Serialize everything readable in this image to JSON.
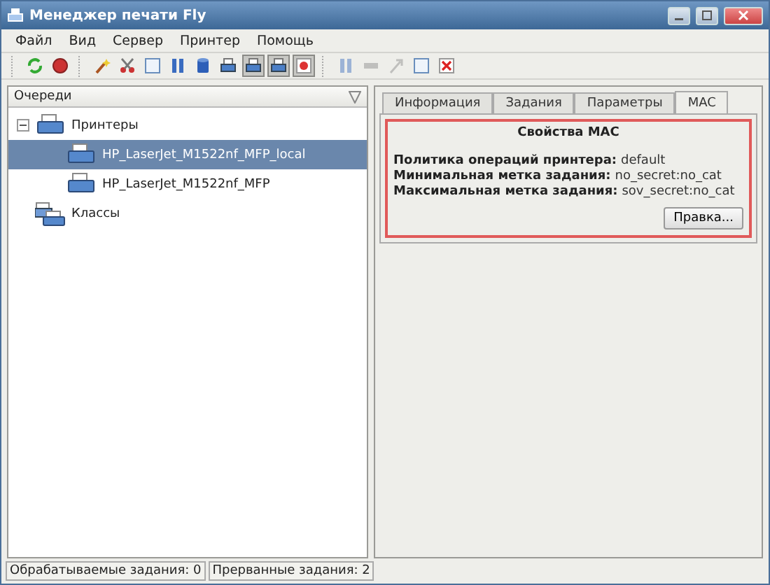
{
  "window": {
    "title": "Менеджер печати Fly"
  },
  "menu": [
    "Файл",
    "Вид",
    "Сервер",
    "Принтер",
    "Помощь"
  ],
  "toolbar": [
    {
      "kind": "refresh",
      "pressed": false,
      "disabled": false
    },
    {
      "kind": "stop",
      "pressed": false,
      "disabled": false
    },
    {
      "kind": "separator"
    },
    {
      "kind": "wand",
      "pressed": false,
      "disabled": false
    },
    {
      "kind": "scissors",
      "pressed": false,
      "disabled": false
    },
    {
      "kind": "page",
      "pressed": false,
      "disabled": false
    },
    {
      "kind": "pause",
      "pressed": false,
      "disabled": false
    },
    {
      "kind": "cylinder",
      "pressed": false,
      "disabled": false
    },
    {
      "kind": "printer",
      "pressed": false,
      "disabled": false
    },
    {
      "kind": "printer",
      "pressed": true,
      "disabled": false
    },
    {
      "kind": "printer",
      "pressed": true,
      "disabled": false
    },
    {
      "kind": "record",
      "pressed": true,
      "disabled": false
    },
    {
      "kind": "separator"
    },
    {
      "kind": "pause",
      "pressed": false,
      "disabled": true
    },
    {
      "kind": "minus",
      "pressed": false,
      "disabled": true
    },
    {
      "kind": "arrow",
      "pressed": false,
      "disabled": true
    },
    {
      "kind": "page",
      "pressed": false,
      "disabled": false
    },
    {
      "kind": "close",
      "pressed": false,
      "disabled": false
    }
  ],
  "queue_panel": {
    "header": "Очереди",
    "tree": [
      {
        "label": "Принтеры",
        "kind": "printer",
        "selected": false,
        "expanded": true,
        "children": [
          {
            "label": "HP_LaserJet_M1522nf_MFP_local",
            "kind": "printer",
            "selected": true
          },
          {
            "label": "HP_LaserJet_M1522nf_MFP",
            "kind": "printer",
            "selected": false
          }
        ]
      },
      {
        "label": "Классы",
        "kind": "class",
        "selected": false
      }
    ]
  },
  "tabs": [
    {
      "label": "Информация",
      "selected": false
    },
    {
      "label": "Задания",
      "selected": false
    },
    {
      "label": "Параметры",
      "selected": false
    },
    {
      "label": "MAC",
      "selected": true
    }
  ],
  "mac_properties": {
    "title": "Свойства MAC",
    "rows": [
      {
        "label": "Политика операций принтера:",
        "value": "default"
      },
      {
        "label": "Минимальная метка задания:",
        "value": "no_secret:no_cat"
      },
      {
        "label": "Максимальная метка задания:",
        "value": "sov_secret:no_cat"
      }
    ],
    "button": "Правка..."
  },
  "status_bar": [
    "Обрабатываемые задания: 0",
    "Прерванные задания: 2"
  ]
}
